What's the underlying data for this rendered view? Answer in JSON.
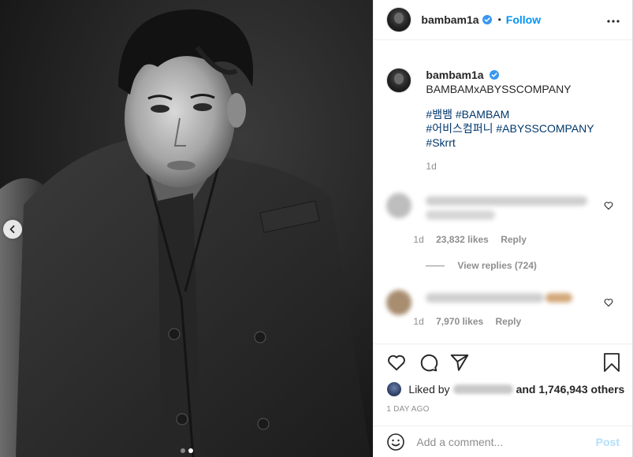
{
  "header": {
    "username": "bambam1a",
    "separator": "•",
    "follow_label": "Follow"
  },
  "caption": {
    "username": "bambam1a",
    "text": "BAMBAMxABYSSCOMPANY",
    "hashtags": [
      "#뱀뱀 #BAMBAM",
      "#어비스컴퍼니 #ABYSSCOMPANY",
      "#Skrrt"
    ],
    "time": "1d"
  },
  "comments": [
    {
      "time": "1d",
      "likes": "23,832 likes",
      "reply_label": "Reply"
    },
    {
      "time": "1d",
      "likes": "7,970 likes",
      "reply_label": "Reply"
    }
  ],
  "view_replies_label": "View replies (724)",
  "likes": {
    "prefix": "Liked by",
    "suffix": "and 1,746,943 others"
  },
  "posted_ago": "1 DAY AGO",
  "comment_box": {
    "placeholder": "Add a comment...",
    "post_label": "Post"
  },
  "carousel": {
    "slides": 2,
    "active": 2
  },
  "colors": {
    "accent": "#0095f6",
    "hashtag": "#00376b",
    "muted": "#8e8e8e",
    "verified": "#3897f0",
    "post_disabled": "#b2dffc"
  }
}
